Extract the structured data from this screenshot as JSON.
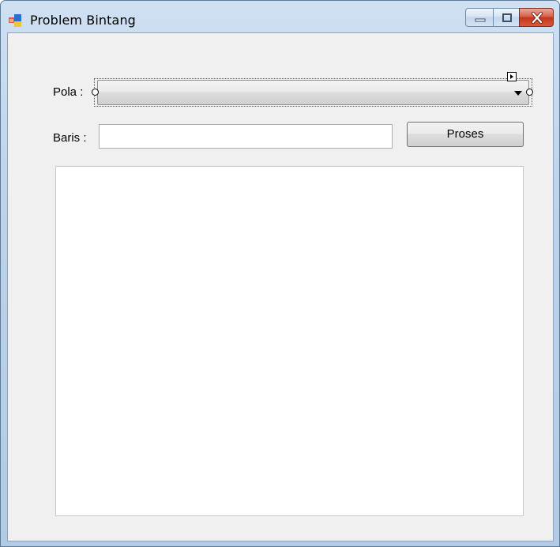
{
  "window": {
    "title": "Problem Bintang",
    "icon": "windows-form-icon",
    "caption_buttons": [
      "minimize-icon",
      "maximize-icon",
      "close-icon"
    ]
  },
  "form": {
    "pola_label": "Pola :",
    "pola_value": "",
    "baris_label": "Baris :",
    "baris_value": "",
    "proses_label": "Proses",
    "output_text": ""
  },
  "colors": {
    "frame": "#b9d1ea",
    "client": "#f0f0f0",
    "close_button": "#c43c23"
  }
}
